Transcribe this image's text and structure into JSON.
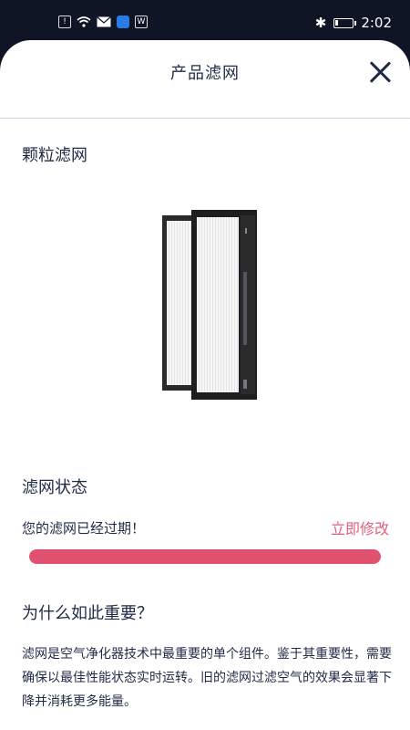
{
  "status_bar": {
    "time": "2:02",
    "notification_icons": [
      "alert-icon",
      "wifi-icon",
      "mail-icon",
      "browser-icon",
      "app-w-icon"
    ],
    "app_w_label": "W",
    "alert_label": "!",
    "bluetooth": "✱"
  },
  "header": {
    "title": "产品滤网"
  },
  "section_filter": {
    "title": "颗粒滤网"
  },
  "section_status": {
    "title": "滤网状态",
    "message": "您的滤网已经过期！",
    "action_label": "立即修改",
    "progress_fraction": 1.0
  },
  "section_why": {
    "title": "为什么如此重要？",
    "description": "滤网是空气净化器技术中最重要的单个组件。鉴于其重要性，需要确保以最佳性能状态实时运转。旧的滤网过滤空气的效果会显著下降并消耗更多能量。"
  },
  "colors": {
    "accent": "#e05f7d",
    "progress": "#e0506f",
    "text": "#1f2a44",
    "status_bar_bg": "#0f1524"
  }
}
